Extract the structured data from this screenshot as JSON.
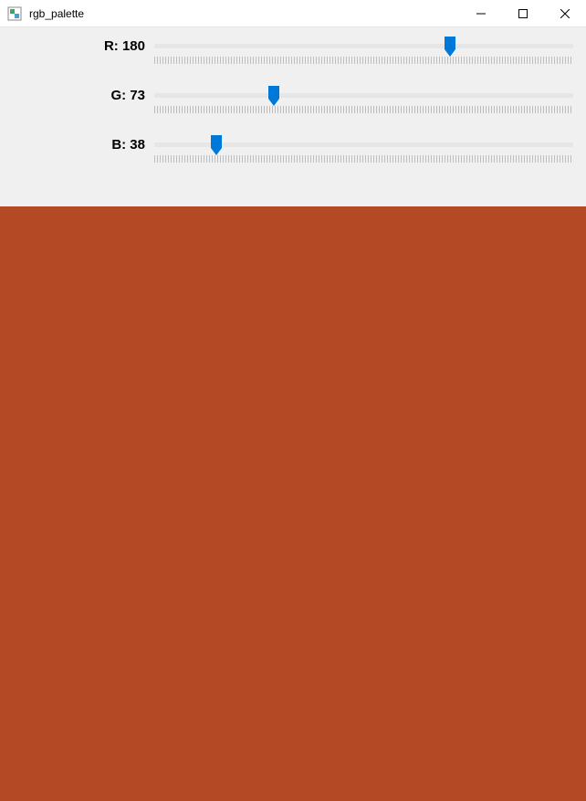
{
  "window": {
    "title": "rgb_palette"
  },
  "sliders": {
    "max": 255,
    "r": {
      "label": "R: 180",
      "value": 180
    },
    "g": {
      "label": "G: 73",
      "value": 73
    },
    "b": {
      "label": "B: 38",
      "value": 38
    }
  },
  "colors": {
    "thumb": "#0078d7",
    "preview_rgb": [
      180,
      73,
      38
    ]
  }
}
